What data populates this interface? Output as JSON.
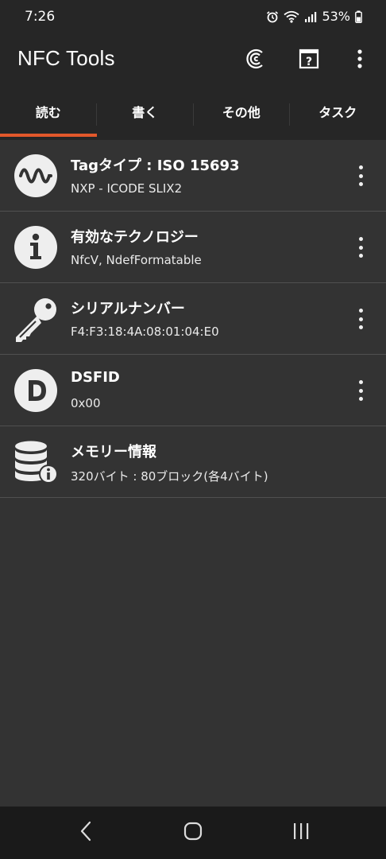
{
  "status": {
    "time": "7:26",
    "battery": "53%"
  },
  "app": {
    "title": "NFC Tools"
  },
  "tabs": [
    {
      "label": "読む",
      "active": true
    },
    {
      "label": "書く",
      "active": false
    },
    {
      "label": "その他",
      "active": false
    },
    {
      "label": "タスク",
      "active": false
    }
  ],
  "items": [
    {
      "title": "Tagタイプ : ISO 15693",
      "subtitle": "NXP - ICODE SLIX2",
      "icon": "wave-icon",
      "has_menu": true
    },
    {
      "title": "有効なテクノロジー",
      "subtitle": "NfcV, NdefFormatable",
      "icon": "info-icon",
      "has_menu": true
    },
    {
      "title": "シリアルナンバー",
      "subtitle": "F4:F3:18:4A:08:01:04:E0",
      "icon": "key-icon",
      "has_menu": true
    },
    {
      "title": "DSFID",
      "subtitle": "0x00",
      "icon": "d-letter-icon",
      "has_menu": true
    },
    {
      "title": "メモリー情報",
      "subtitle": "320バイト : 80ブロック(各4バイト)",
      "icon": "database-info-icon",
      "has_menu": false
    }
  ],
  "colors": {
    "accent": "#e2582b",
    "background": "#333333",
    "toolbar": "#262626",
    "navbar": "#1a1a1a",
    "divider": "#505050"
  }
}
